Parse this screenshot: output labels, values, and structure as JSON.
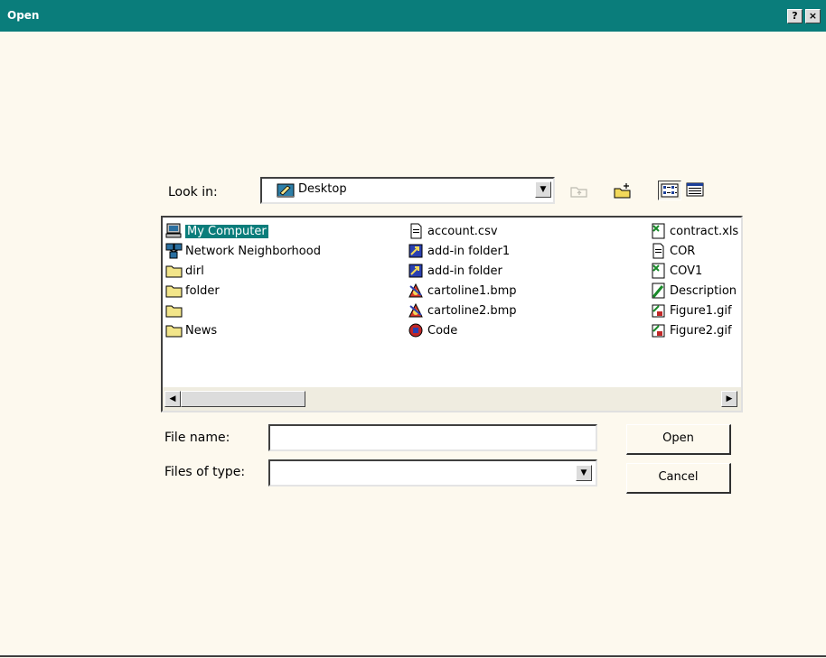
{
  "window": {
    "title": "Open",
    "help_button": "?",
    "close_button": "×"
  },
  "look_in": {
    "label": "Look in:",
    "value": "Desktop"
  },
  "toolbar": {
    "up_folder": "up-one-level-icon",
    "new_folder": "create-new-folder-icon",
    "list_view": "list-view-icon",
    "details_view": "details-view-icon"
  },
  "files": {
    "column1": [
      {
        "name": "My Computer",
        "icon": "my-computer-icon",
        "selected": true
      },
      {
        "name": "Network Neighborhood",
        "icon": "network-neighborhood-icon"
      },
      {
        "name": "dirl",
        "icon": "folder-icon"
      },
      {
        "name": "folder",
        "icon": "folder-icon"
      },
      {
        "name": "",
        "icon": "folder-icon"
      },
      {
        "name": "News",
        "icon": "folder-icon"
      }
    ],
    "column2": [
      {
        "name": "account.csv",
        "icon": "document-icon"
      },
      {
        "name": "add-in folder1",
        "icon": "shortcut-icon"
      },
      {
        "name": "add-in folder",
        "icon": "shortcut-icon"
      },
      {
        "name": "cartoline1.bmp",
        "icon": "bitmap-icon"
      },
      {
        "name": "cartoline2.bmp",
        "icon": "bitmap-icon"
      },
      {
        "name": "Code",
        "icon": "application-icon"
      }
    ],
    "column3": [
      {
        "name": "contract.xls",
        "icon": "spreadsheet-icon"
      },
      {
        "name": "COR",
        "icon": "document-icon"
      },
      {
        "name": "COV1",
        "icon": "spreadsheet-icon"
      },
      {
        "name": "Description",
        "icon": "paint-document-icon"
      },
      {
        "name": "Figure1.gif",
        "icon": "image-icon"
      },
      {
        "name": "Figure2.gif",
        "icon": "image-icon"
      }
    ]
  },
  "file_name": {
    "label": "File name:",
    "value": ""
  },
  "file_type": {
    "label": "Files of type:",
    "value": ""
  },
  "buttons": {
    "open": "Open",
    "cancel": "Cancel"
  }
}
